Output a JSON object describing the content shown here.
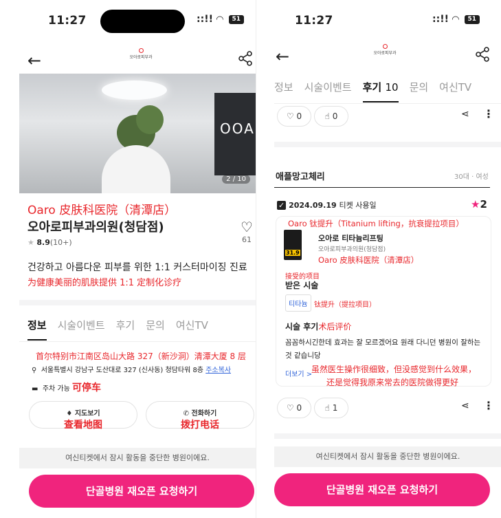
{
  "left": {
    "status": {
      "time": "11:27",
      "signal": "::!! ",
      "battery": "51"
    },
    "header": {
      "logo_text": "오아로피부과"
    },
    "hero": {
      "pager": "2 / 10",
      "wall_text": "OOA"
    },
    "clinic": {
      "name_cn": "Oaro 皮肤科医院（清潭店）",
      "name_kr": "오아로피부과의원(청담점)",
      "rating": "8.9",
      "rating_count": "(10+)",
      "likes": "61",
      "desc_kr": "건강하고 아름다운 피부를 위한 1:1 커스터마이징 진료",
      "desc_cn": "为健康美丽的肌肤提供 1:1 定制化诊疗"
    },
    "tabs": [
      "정보",
      "시술이벤트",
      "후기",
      "문의",
      "여신TV"
    ],
    "address_cn": "首尔特别市江南区岛山大路 327（新沙洞）清潭大厦 8 层",
    "address_kr": "서울특별시 강남구 도산대로 327 (신사동) 청담타워 8층",
    "copy_address": "주소복사",
    "parking_kr": "주차 가능",
    "parking_cn": "可停车",
    "map_btn": {
      "kr": "지도보기",
      "cn": "查看地图"
    },
    "call_btn": {
      "kr": "전화하기",
      "cn": "拨打电话"
    },
    "notice": "여신티켓에서 잠시 활동을 중단한 병원이에요.",
    "cta": "단골병원 재오픈 요청하기"
  },
  "right": {
    "status": {
      "time": "11:27",
      "battery": "51"
    },
    "header": {
      "logo_text": "오아로피부과"
    },
    "tabs": [
      "정보",
      "시술이벤트",
      "후기",
      "10",
      "문의",
      "여신TV"
    ],
    "top_actions": {
      "heart": "0",
      "thumb": "0"
    },
    "reviewer": "애플망고체리",
    "reviewer_meta": "30대 · 여성",
    "ticket_date": "2024.09.19",
    "ticket_label": "티켓 사용일",
    "star_count": "2",
    "product_cn": "Oaro 钛提升（Titanium lifting，抗衰提拉项目）",
    "product_kr": "오아로 티타늄리프팅",
    "product_clinic_kr": "오아로피부과의원(청담점)",
    "product_clinic_cn": "Oaro 皮肤科医院（清潭店）",
    "thumb_badge": "31.9",
    "received_cn": "接受的项目",
    "received_kr": "받은 시술",
    "chip_kr": "티타늄",
    "chip_cn": "钛提升（提拉项目）",
    "review_title_kr": "시술 후기",
    "review_title_cn": "术后评价",
    "review_body": "꼼꼼하시긴한데 효과는 잘 모르겠어요 원래 다니던 병원이 잘하는 것 같습니당",
    "more": "더보기 >",
    "review_cn_1": "虽然医生操作很细致，但没感觉到什么效果，",
    "review_cn_2": "还是觉得我原来常去的医院做得更好",
    "bottom_actions": {
      "heart": "0",
      "thumb": "1"
    },
    "notice": "여신티켓에서 잠시 활동을 중단한 병원이에요.",
    "cta": "단골병원 재오픈 요청하기"
  }
}
